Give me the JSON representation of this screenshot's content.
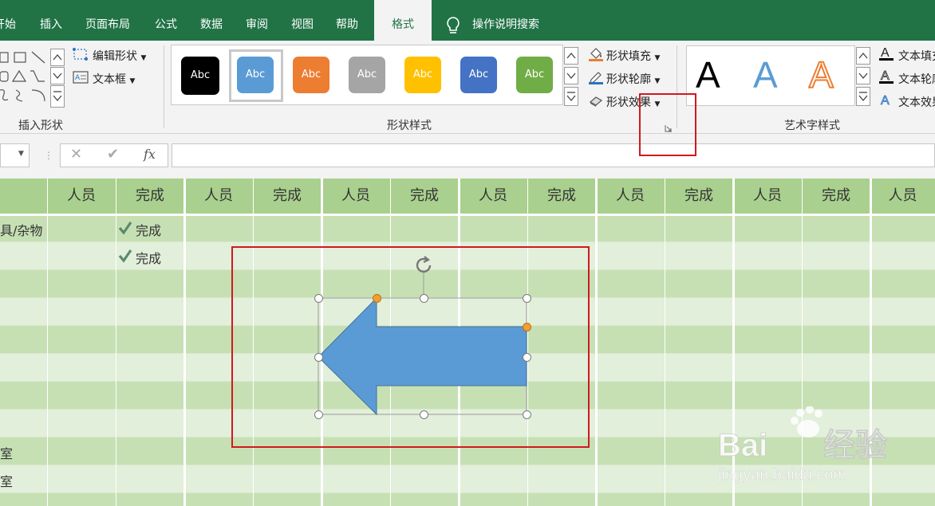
{
  "tabs": [
    {
      "id": "home",
      "label": "开始",
      "active": false
    },
    {
      "id": "insert",
      "label": "插入",
      "active": false
    },
    {
      "id": "page-layout",
      "label": "页面布局",
      "active": false
    },
    {
      "id": "formulas",
      "label": "公式",
      "active": false
    },
    {
      "id": "data",
      "label": "数据",
      "active": false
    },
    {
      "id": "review",
      "label": "审阅",
      "active": false
    },
    {
      "id": "view",
      "label": "视图",
      "active": false
    },
    {
      "id": "help",
      "label": "帮助",
      "active": false
    },
    {
      "id": "format",
      "label": "格式",
      "active": true
    }
  ],
  "tell_me": {
    "label": "操作说明搜索"
  },
  "ribbon": {
    "insert_shapes": {
      "label": "插入形状",
      "edit_shape": "编辑形状",
      "text_box": "文本框"
    },
    "shape_styles": {
      "label": "形状样式",
      "swatch_text": "Abc",
      "swatches": [
        {
          "color": "#000000",
          "selected": false
        },
        {
          "color": "#5b9bd5",
          "selected": true
        },
        {
          "color": "#ed7d31",
          "selected": false
        },
        {
          "color": "#a5a5a5",
          "selected": false
        },
        {
          "color": "#ffc000",
          "selected": false
        },
        {
          "color": "#4472c4",
          "selected": false
        },
        {
          "color": "#70ad47",
          "selected": false
        }
      ],
      "fill": "形状填充",
      "outline": "形状轮廓",
      "effects": "形状效果"
    },
    "wordart": {
      "label": "艺术字样式",
      "sample": "A",
      "text_fill": "文本填充",
      "text_outline": "文本轮廓",
      "text_effects": "文本效果"
    }
  },
  "formula_bar": {
    "fx": "fx",
    "value": ""
  },
  "sheet": {
    "header": [
      "人员",
      "完成",
      "人员",
      "完成",
      "人员",
      "完成",
      "人员",
      "完成",
      "人员",
      "完成",
      "人员",
      "完成",
      "人员"
    ],
    "first_col": [
      "具/杂物",
      "",
      "",
      "",
      "",
      "",
      "",
      "",
      "室",
      "室"
    ],
    "done_label": "完成"
  },
  "colors": {
    "accent": "#217346",
    "header_green": "#a9d08e",
    "row_light": "#e3efd9",
    "highlight_red": "#d0191e",
    "arrow_blue": "#5b9bd5"
  },
  "watermark": {
    "brand": "Bai du 经验",
    "url": "jingyan.baidu.com"
  }
}
